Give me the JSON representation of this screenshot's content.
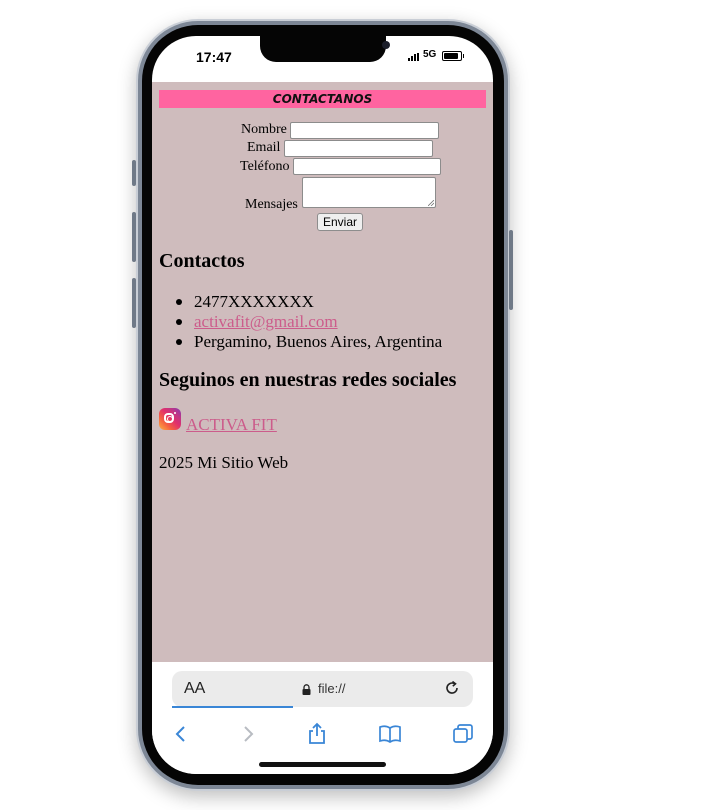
{
  "status_bar": {
    "time": "17:47",
    "network": "5G",
    "battery_level": 0.85
  },
  "banner": {
    "title": "CONTACTANOS",
    "color": "#ff64a0"
  },
  "form": {
    "name_label": "Nombre",
    "email_label": "Email",
    "phone_label": "Teléfono",
    "message_label": "Mensajes",
    "name_value": "",
    "email_value": "",
    "phone_value": "",
    "message_value": "",
    "submit_label": "Enviar"
  },
  "contacts": {
    "heading": "Contactos",
    "items": [
      "2477XXXXXXX",
      "activafit@gmail.com",
      "Pergamino, Buenos Aires, Argentina"
    ]
  },
  "social": {
    "heading": "Seguinos en nuestras redes sociales",
    "icon": "instagram-icon",
    "link_text": "ACTIVA FIT"
  },
  "footer": {
    "text": "2025 Mi Sitio Web"
  },
  "browser": {
    "text_size_label": "AA",
    "url": "file://",
    "toolbar_icons": [
      "back-icon",
      "forward-icon",
      "share-icon",
      "bookmarks-icon",
      "tabs-icon"
    ]
  },
  "colors": {
    "page_background": "#cfbcbd",
    "link": "#cc5c8b",
    "browser_accent": "#3a86d6"
  }
}
